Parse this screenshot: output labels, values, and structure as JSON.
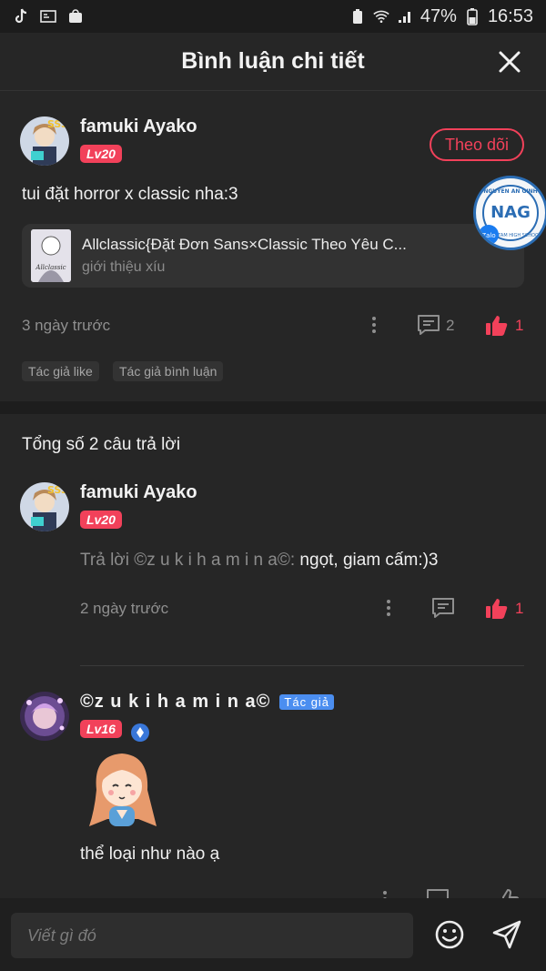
{
  "status": {
    "battery": "47%",
    "time": "16:53"
  },
  "header": {
    "title": "Bình luận chi tiết"
  },
  "comment": {
    "username": "famuki Ayako",
    "level": "Lv20",
    "follow_label": "Theo dõi",
    "text": "tui đặt horror x classic nha:3",
    "story": {
      "title": "Allclassic{Đặt Đơn Sans×Classic Theo Yêu C...",
      "subtitle": "giới thiệu xíu",
      "thumb_text": "Allclassic"
    },
    "time": "3 ngày trước",
    "reply_count": "2",
    "like_count": "1",
    "tags": [
      "Tác giả like",
      "Tác giả bình luận"
    ]
  },
  "overlay_badge": {
    "text": "NAG",
    "ring_text": "NGUYEN AN GINH",
    "sub_text": "TAM HIGH SCHOOL",
    "zalo": "Zalo"
  },
  "replies_header": "Tổng số 2 câu trả lời",
  "replies": [
    {
      "username": "famuki Ayako",
      "level": "Lv20",
      "reply_prefix": "Trả lời ©z u k i h a m i n a©:",
      "text": " ngọt, giam cấm:)3",
      "time": "2 ngày trước",
      "like_count": "1"
    },
    {
      "username": "©z u k i h a m i n a©",
      "author_tag": "Tác giả",
      "level": "Lv16",
      "text": "thể loại như nào ạ"
    }
  ],
  "input": {
    "placeholder": "Viết gì đó"
  },
  "colors": {
    "accent": "#f2415a",
    "background": "#262626",
    "author_tag": "#4b8ef0"
  }
}
